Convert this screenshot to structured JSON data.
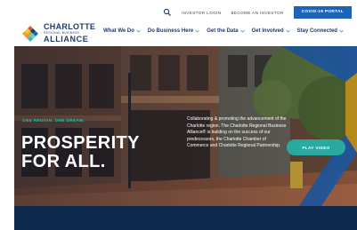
{
  "utility_bar": {
    "search_icon": "search-icon",
    "investor_login": "INVESTOR LOGIN",
    "become_investor": "BECOME AN INVESTOR",
    "covid_portal": "COVID-19 PORTAL"
  },
  "logo": {
    "line1": "CHARLOTTE",
    "line2": "REGIONAL BUSINESS",
    "line3": "ALLIANCE",
    "mark_colors": [
      "#e4572e",
      "#f2a900",
      "#2bbdb3",
      "#1d63b8",
      "#8bc34a"
    ]
  },
  "nav": {
    "items": [
      {
        "label": "What We Do"
      },
      {
        "label": "Do Business Here"
      },
      {
        "label": "Get the Data"
      },
      {
        "label": "Get Involved"
      },
      {
        "label": "Stay Connected"
      }
    ]
  },
  "hero": {
    "eyebrow": "ONE REGION. ONE DREAM.",
    "headline_line1": "PROSPERITY",
    "headline_line2": "FOR ALL.",
    "blurb": "Collaborating & promoting the advancement of the Charlotte region. The Charlotte Regional Business Alliance® is building on the success of our predecessors, the Charlotte Chamber of Commerce and Charlotte Regional Partnership.",
    "play_label": "PLAY VIDEO"
  },
  "colors": {
    "navy": "#1f3a6e",
    "accent_blue": "#1d63b8",
    "teal": "#2aa9a0",
    "footer_band": "#0f2a4c"
  }
}
